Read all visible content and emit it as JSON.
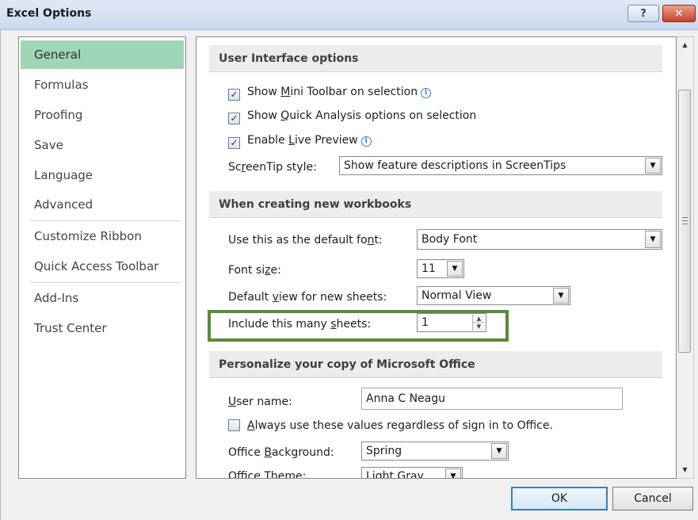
{
  "window": {
    "title": "Excel Options",
    "help_label": "?",
    "close_label": "✕"
  },
  "nav": {
    "items": [
      {
        "label": "General",
        "selected": true
      },
      {
        "label": "Formulas"
      },
      {
        "label": "Proofing"
      },
      {
        "label": "Save"
      },
      {
        "label": "Language"
      },
      {
        "label": "Advanced"
      },
      {
        "label": "Customize Ribbon"
      },
      {
        "label": "Quick Access Toolbar"
      },
      {
        "label": "Add-Ins"
      },
      {
        "label": "Trust Center"
      }
    ]
  },
  "ui_options": {
    "header": "User Interface options",
    "mini_toolbar": {
      "pre": "Show ",
      "key": "M",
      "post": "ini Toolbar on selection",
      "checked": true
    },
    "quick_analysis": {
      "pre": "Show ",
      "key": "Q",
      "post": "uick Analysis options on selection",
      "checked": true
    },
    "live_preview": {
      "pre": "Enable ",
      "key": "L",
      "post": "ive Preview",
      "checked": true
    },
    "screentip": {
      "pre": "Sc",
      "key": "r",
      "post": "eenTip style:",
      "value": "Show feature descriptions in ScreenTips"
    }
  },
  "new_workbooks": {
    "header": "When creating new workbooks",
    "default_font": {
      "pre": "Use this as the default fo",
      "key": "n",
      "post": "t:",
      "value": "Body Font"
    },
    "font_size": {
      "pre": "Font si",
      "key": "z",
      "post": "e:",
      "value": "11"
    },
    "default_view": {
      "pre": "Default ",
      "key": "v",
      "post": "iew for new sheets:",
      "value": "Normal View"
    },
    "sheets": {
      "pre": "Include this many ",
      "key": "s",
      "post": "heets:",
      "value": "1"
    }
  },
  "personalize": {
    "header": "Personalize your copy of Microsoft Office",
    "user_name": {
      "key": "U",
      "post": "ser name:",
      "value": "Anna C Neagu"
    },
    "always_use": {
      "key": "A",
      "post": "lways use these values regardless of sign in to Office.",
      "checked": false
    },
    "background": {
      "pre": "Office ",
      "key": "B",
      "post": "ackground:",
      "value": "Spring"
    },
    "theme": {
      "pre": "Office ",
      "key": "T",
      "post": "heme:",
      "value": "Light Gray"
    }
  },
  "footer": {
    "ok_label": "OK",
    "cancel_label": "Cancel"
  },
  "colors": {
    "nav_selected": "#9fd5b7",
    "highlight_border": "#5a8a3a"
  }
}
